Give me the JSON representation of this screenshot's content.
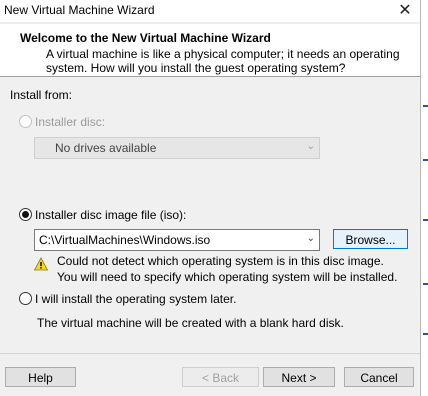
{
  "window": {
    "title": "New Virtual Machine Wizard",
    "close_glyph": "✕"
  },
  "header": {
    "title": "Welcome to the New Virtual Machine Wizard",
    "desc_line1": "A virtual machine is like a physical computer; it needs an operating",
    "desc_line2": "system. How will you install the guest operating system?"
  },
  "install_from": {
    "label": "Install from:"
  },
  "options": {
    "disc": {
      "label": "Installer disc:",
      "selected": false,
      "enabled": false,
      "drive_value": "No drives available"
    },
    "iso": {
      "label": "Installer disc image file (iso):",
      "selected": true,
      "path": "C:\\VirtualMachines\\Windows.iso",
      "browse_label": "Browse...",
      "warning_line1": "Could not detect which operating system is in this disc image.",
      "warning_line2": "You will need to specify which operating system will be installed."
    },
    "later": {
      "label": "I will install the operating system later.",
      "selected": false,
      "note": "The virtual machine will be created with a blank hard disk."
    }
  },
  "footer": {
    "help": "Help",
    "back": "< Back",
    "next": "Next >",
    "cancel": "Cancel"
  },
  "colors": {
    "focus_border": "#0078d7",
    "warning_yellow": "#f7d92d"
  }
}
